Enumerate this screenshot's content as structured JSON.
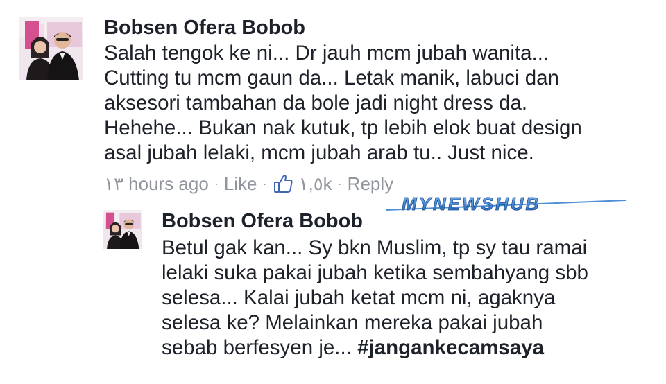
{
  "comment": {
    "author": "Bobsen Ofera Bobob",
    "lines": [
      "Salah tengok ke ni... Dr jauh mcm jubah wanita...",
      "Cutting tu mcm gaun da... Letak manik, labuci dan",
      "aksesori tambahan da bole jadi night dress da.",
      "Hehehe... Bukan nak kutuk, tp lebih elok buat design",
      "asal jubah lelaki, mcm jubah arab tu.. Just nice."
    ],
    "time": "١٣ hours ago",
    "like_label": "Like",
    "like_count": "١,٥k",
    "reply_label": "Reply",
    "separator": "·",
    "avatar_icon": "profile-photo-couple"
  },
  "reply": {
    "author": "Bobsen Ofera Bobob",
    "lines": [
      "Betul gak kan... Sy bkn Muslim, tp sy tau ramai",
      "lelaki suka pakai jubah ketika sembahyang sbb",
      "selesa... Kalai jubah ketat mcm ni, agaknya",
      "selesa ke? Melainkan mereka pakai jubah",
      "sebab berfesyen je..."
    ],
    "hashtag": "#jangankecamsaya",
    "avatar_icon": "profile-photo-couple"
  },
  "watermark": {
    "text": "MYNEWSHUB",
    "color": "#2a7bd0"
  },
  "colors": {
    "text": "#1d2129",
    "meta": "#90949c",
    "like_icon": "#4267b2"
  }
}
